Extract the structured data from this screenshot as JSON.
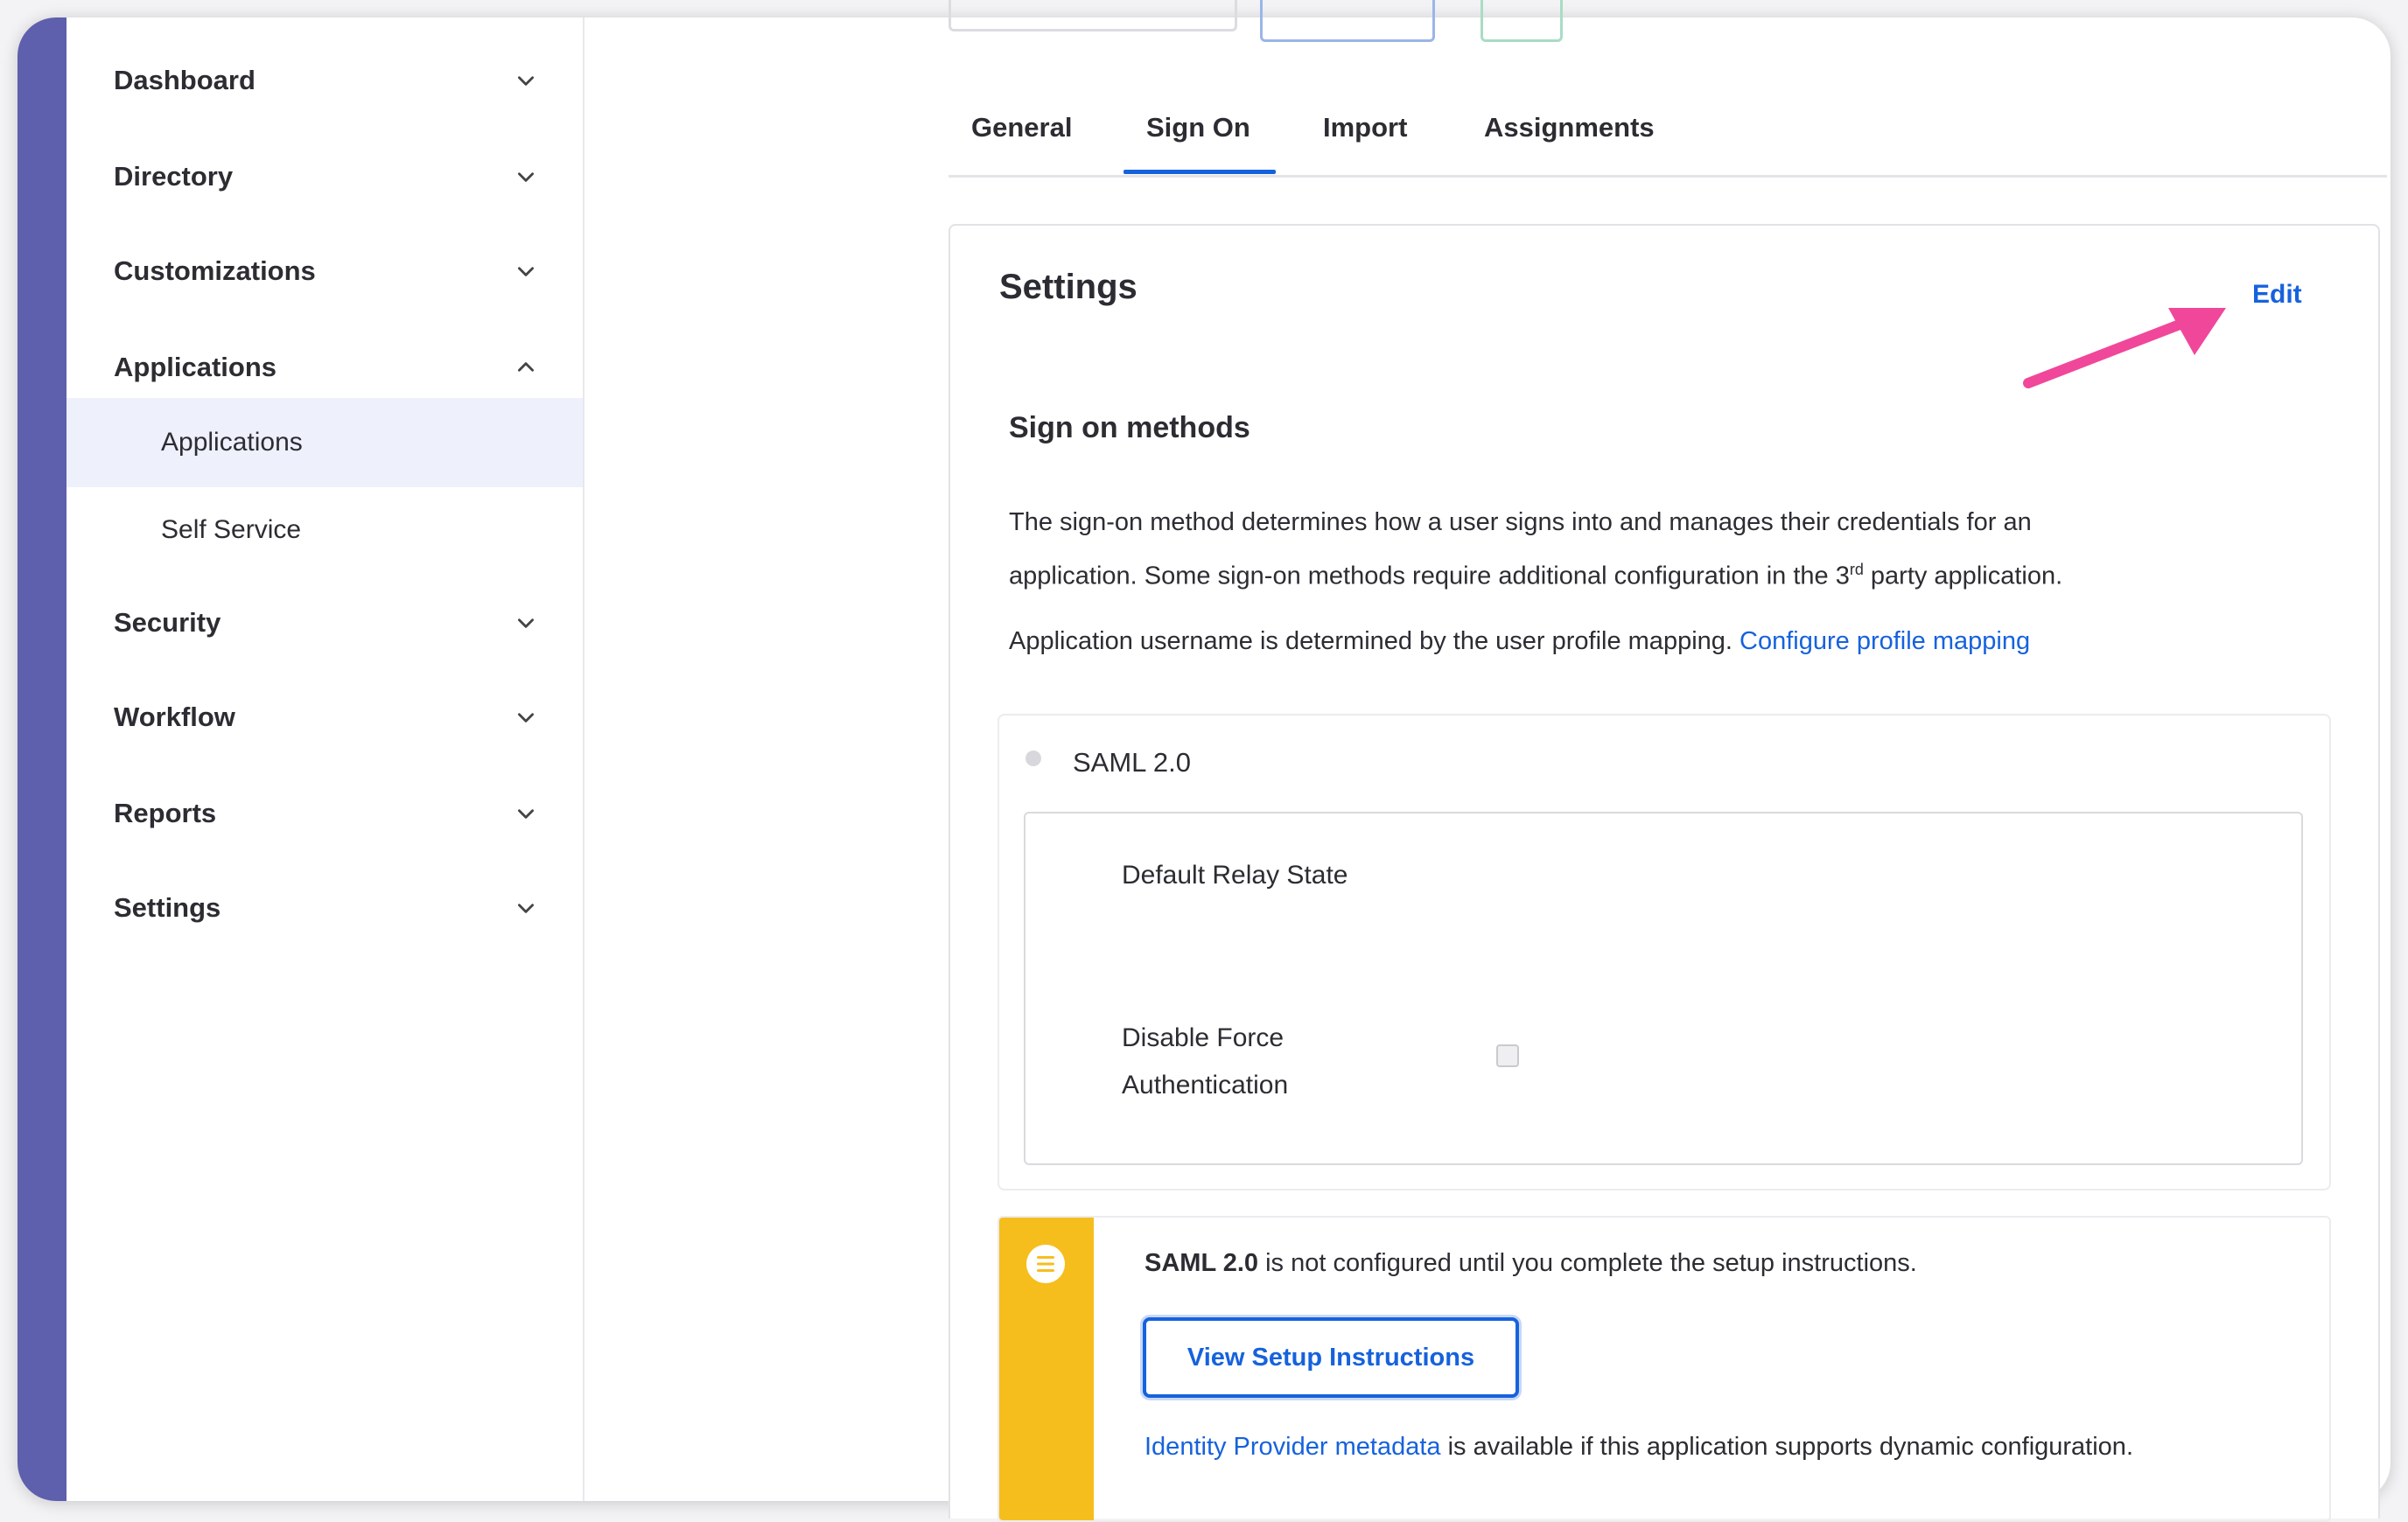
{
  "sidebar": {
    "items": [
      {
        "label": "Dashboard"
      },
      {
        "label": "Directory"
      },
      {
        "label": "Customizations"
      },
      {
        "label": "Applications"
      },
      {
        "label": "Applications"
      },
      {
        "label": "Self Service"
      },
      {
        "label": "Security"
      },
      {
        "label": "Workflow"
      },
      {
        "label": "Reports"
      },
      {
        "label": "Settings"
      }
    ]
  },
  "tabs": [
    {
      "label": "General"
    },
    {
      "label": "Sign On"
    },
    {
      "label": "Import"
    },
    {
      "label": "Assignments"
    }
  ],
  "settings": {
    "title": "Settings",
    "edit_label": "Edit",
    "methods_title": "Sign on methods",
    "description_line1": "The sign-on method determines how a user signs into and manages their credentials for an",
    "description_line2_pre": "application. Some sign-on methods require additional configuration in the 3",
    "description_sup": "rd",
    "description_line2_post": " party application.",
    "username_text": "Application username is determined by the user profile mapping.",
    "configure_link": "Configure profile mapping"
  },
  "saml": {
    "label": "SAML 2.0",
    "relay_state_label": "Default Relay State",
    "force_auth_line1": "Disable Force",
    "force_auth_line2": "Authentication"
  },
  "callout": {
    "bold": "SAML 2.0",
    "text": " is not configured until you complete the setup instructions.",
    "button_label": "View Setup Instructions",
    "idp_link": "Identity Provider metadata",
    "idp_text": " is available if this application supports dynamic configuration."
  },
  "colors": {
    "accent": "#5e5fad",
    "link": "#1662dd",
    "warning": "#f6be1d",
    "arrow": "#f0479b"
  }
}
